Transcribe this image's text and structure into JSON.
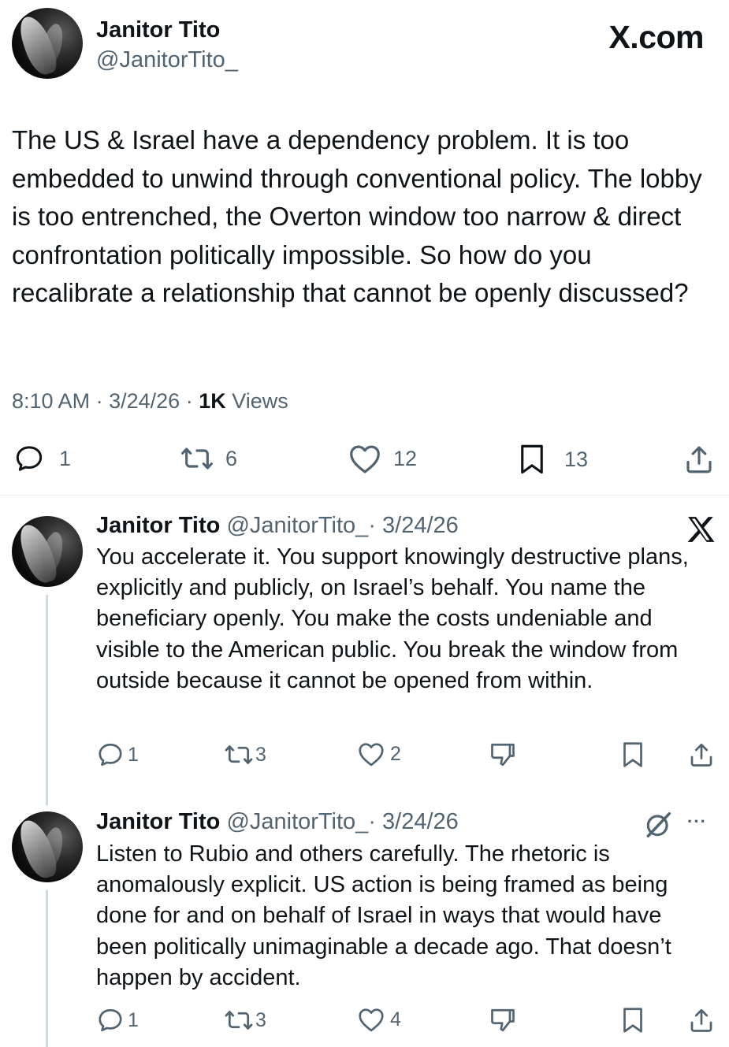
{
  "header": {
    "author_name": "Janitor Tito",
    "author_handle": "@JanitorTito_",
    "site_logo": "X.com"
  },
  "main_post": {
    "text": "The US & Israel have a dependency problem. It is too embedded to unwind through conventional policy. The lobby is too entrenched, the Overton window too narrow & direct confrontation politically impossible. So how do you recalibrate a relationship that cannot be openly discussed?",
    "time": "8:10 AM",
    "date": "3/24/26",
    "separator": "·",
    "views_count": "1K",
    "views_label": "Views",
    "replies": "1",
    "reposts": "6",
    "likes": "12",
    "bookmarks": "13"
  },
  "replies": [
    {
      "author_name": "Janitor Tito",
      "author_handle": "@JanitorTito_",
      "date": "· 3/24/26",
      "text": "You accelerate it. You support knowingly destructive plans, explicitly and publicly, on Israel’s behalf. You name the beneficiary openly. You make the costs undeniable and visible to the American public. You break the window from outside because it cannot be opened from within.",
      "replies": "1",
      "reposts": "3",
      "likes": "2",
      "corner_icon": "x-logo-icon"
    },
    {
      "author_name": "Janitor Tito",
      "author_handle": "@JanitorTito_",
      "date": "· 3/24/26",
      "text": "Listen to Rubio and others carefully. The rhetoric is anomalously explicit. US action is being framed as being done for and on behalf of Israel in ways that would have been politically unimaginable a decade ago. That doesn’t happen by accident.",
      "replies": "1",
      "reposts": "3",
      "likes": "4",
      "corner_icon": "grok-icon",
      "more_label": "···"
    }
  ],
  "colors": {
    "text": "#0f1419",
    "secondary": "#536471",
    "thread_line": "#cfd9de",
    "divider": "#e6ecf0"
  }
}
